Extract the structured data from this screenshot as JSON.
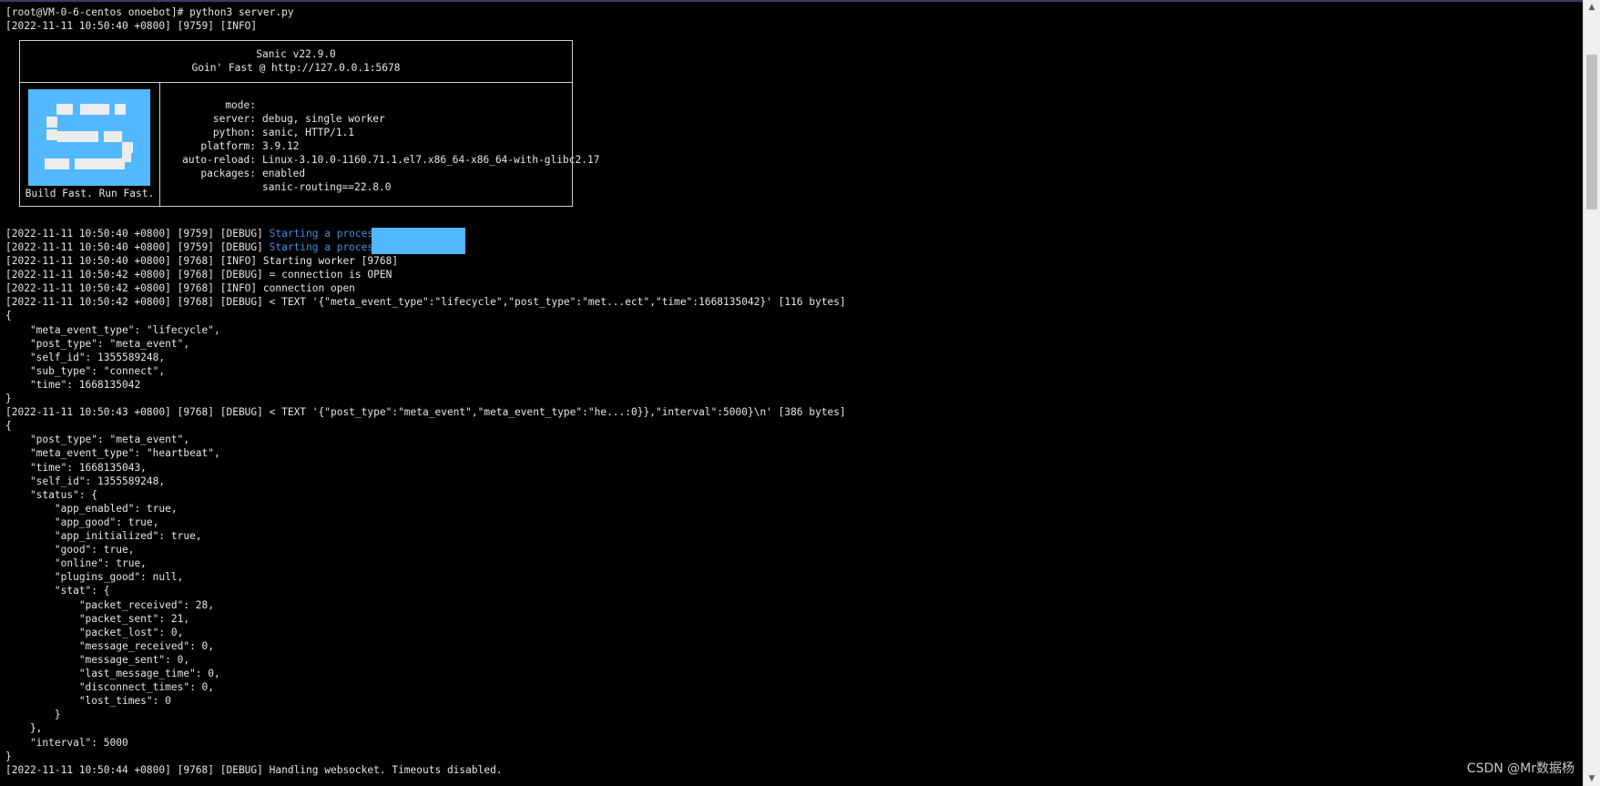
{
  "colors": {
    "background": "#000000",
    "text": "#e6e6e6",
    "highlight": "#3f8fdc",
    "redaction": "#52b8ff",
    "logo": "#52b8ff"
  },
  "terminal": {
    "prompt_line": "[root@VM-0-6-centos onoebot]# python3 server.py",
    "info_line": "[2022-11-11 10:50:40 +0800] [9759] [INFO]",
    "banner": {
      "title": "Sanic v22.9.0",
      "subtitle": "Goin' Fast @ http://127.0.0.1:5678",
      "tagline": "Build Fast. Run Fast.",
      "details": [
        {
          "key": "mode:",
          "value": "debug, single worker"
        },
        {
          "key": "server:",
          "value": "sanic, HTTP/1.1"
        },
        {
          "key": "python:",
          "value": "3.9.12"
        },
        {
          "key": "platform:",
          "value": "Linux-3.10.0-1160.71.1.el7.x86_64-x86_64-with-glibc2.17"
        },
        {
          "key": "auto-reload:",
          "value": "enabled"
        },
        {
          "key": "packages:",
          "value": "sanic-routing==22.8.0"
        }
      ]
    },
    "process_lines": [
      {
        "prefix": "[2022-11-11 10:50:40 +0800] [9759] [DEBUG] ",
        "message": "Starting a process:"
      },
      {
        "prefix": "[2022-11-11 10:50:40 +0800] [9759] [DEBUG] ",
        "message": "Starting a process:"
      }
    ],
    "log_lines": [
      "[2022-11-11 10:50:40 +0800] [9768] [INFO] Starting worker [9768]",
      "[2022-11-11 10:50:42 +0800] [9768] [DEBUG] = connection is OPEN",
      "[2022-11-11 10:50:42 +0800] [9768] [INFO] connection open",
      "[2022-11-11 10:50:42 +0800] [9768] [DEBUG] < TEXT '{\"meta_event_type\":\"lifecycle\",\"post_type\":\"met...ect\",\"time\":1668135042}' [116 bytes]",
      "{",
      "    \"meta_event_type\": \"lifecycle\",",
      "    \"post_type\": \"meta_event\",",
      "    \"self_id\": 1355589248,",
      "    \"sub_type\": \"connect\",",
      "    \"time\": 1668135042",
      "}",
      "[2022-11-11 10:50:43 +0800] [9768] [DEBUG] < TEXT '{\"post_type\":\"meta_event\",\"meta_event_type\":\"he...:0}},\"interval\":5000}\\n' [386 bytes]",
      "{",
      "    \"post_type\": \"meta_event\",",
      "    \"meta_event_type\": \"heartbeat\",",
      "    \"time\": 1668135043,",
      "    \"self_id\": 1355589248,",
      "    \"status\": {",
      "        \"app_enabled\": true,",
      "        \"app_good\": true,",
      "        \"app_initialized\": true,",
      "        \"good\": true,",
      "        \"online\": true,",
      "        \"plugins_good\": null,",
      "        \"stat\": {",
      "            \"packet_received\": 28,",
      "            \"packet_sent\": 21,",
      "            \"packet_lost\": 0,",
      "            \"message_received\": 0,",
      "            \"message_sent\": 0,",
      "            \"last_message_time\": 0,",
      "            \"disconnect_times\": 0,",
      "            \"lost_times\": 0",
      "        }",
      "    },",
      "    \"interval\": 5000",
      "}",
      "[2022-11-11 10:50:44 +0800] [9768] [DEBUG] Handling websocket. Timeouts disabled."
    ]
  },
  "scrollbar": {
    "up_icon": "▲",
    "down_icon": "▼"
  },
  "watermark": "CSDN @Mr数据杨"
}
